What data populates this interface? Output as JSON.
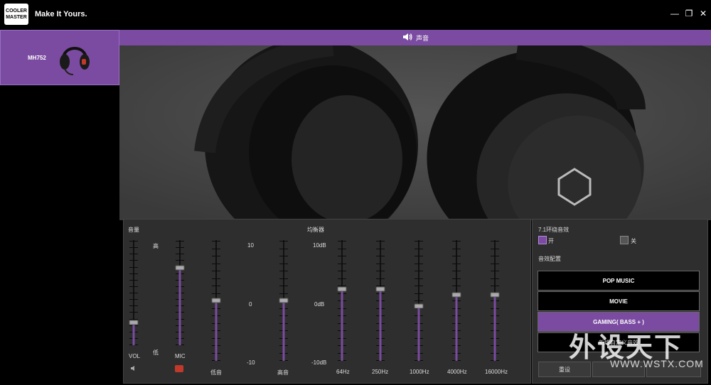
{
  "app": {
    "logo_text": "COOLER MASTER",
    "slogan": "Make It Yours.",
    "window_controls": {
      "minimize": "minimize-icon",
      "restore": "restore-icon",
      "close": "close-icon"
    }
  },
  "sidebar": {
    "device_name": "MH752"
  },
  "topbar": {
    "label": "声音",
    "icon": "speaker-icon"
  },
  "volume": {
    "title": "音量",
    "high_label": "高",
    "low_label": "低",
    "vol_label": "VOL",
    "mic_label": "MIC",
    "vol_level": 0.2,
    "mic_level": 0.75
  },
  "equalizer": {
    "title": "均衡器",
    "bass_label": "低音",
    "treble_label": "高音",
    "bass_scale": [
      "10",
      "0",
      "-10"
    ],
    "db_scale": [
      "10dB",
      "0dB",
      "-10dB"
    ],
    "bass_level": 0.5,
    "treble_level": 0.5,
    "bands": [
      {
        "label": "64Hz",
        "level": 0.6
      },
      {
        "label": "250Hz",
        "level": 0.6
      },
      {
        "label": "1000Hz",
        "level": 0.45
      },
      {
        "label": "4000Hz",
        "level": 0.55
      },
      {
        "label": "16000Hz",
        "level": 0.55
      }
    ]
  },
  "surround": {
    "title": "7.1环绕音效",
    "on_label": "开",
    "off_label": "关",
    "selected": "on"
  },
  "presets": {
    "title": "音效配置",
    "items": [
      "POP MUSIC",
      "MOVIE",
      "GAMING( BASS + )"
    ],
    "active_index": 2,
    "add_label": "新增自定义音效",
    "reset_label": "重设"
  },
  "watermark": {
    "text": "外设天下",
    "url": "WWW.WSTX.COM"
  },
  "colors": {
    "accent": "#7a4ba0",
    "panel": "#2e2e2e",
    "background": "#000000"
  }
}
